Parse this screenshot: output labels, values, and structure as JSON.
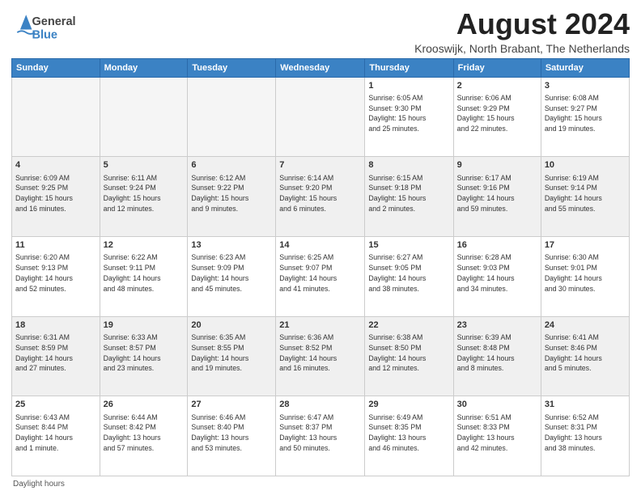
{
  "header": {
    "logo_line1": "General",
    "logo_line2": "Blue",
    "month_title": "August 2024",
    "subtitle": "Krooswijk, North Brabant, The Netherlands"
  },
  "footer": {
    "daylight_label": "Daylight hours"
  },
  "weekdays": [
    "Sunday",
    "Monday",
    "Tuesday",
    "Wednesday",
    "Thursday",
    "Friday",
    "Saturday"
  ],
  "weeks": [
    [
      {
        "day": "",
        "info": "",
        "empty": true
      },
      {
        "day": "",
        "info": "",
        "empty": true
      },
      {
        "day": "",
        "info": "",
        "empty": true
      },
      {
        "day": "",
        "info": "",
        "empty": true
      },
      {
        "day": "1",
        "info": "Sunrise: 6:05 AM\nSunset: 9:30 PM\nDaylight: 15 hours\nand 25 minutes.",
        "empty": false
      },
      {
        "day": "2",
        "info": "Sunrise: 6:06 AM\nSunset: 9:29 PM\nDaylight: 15 hours\nand 22 minutes.",
        "empty": false
      },
      {
        "day": "3",
        "info": "Sunrise: 6:08 AM\nSunset: 9:27 PM\nDaylight: 15 hours\nand 19 minutes.",
        "empty": false
      }
    ],
    [
      {
        "day": "4",
        "info": "Sunrise: 6:09 AM\nSunset: 9:25 PM\nDaylight: 15 hours\nand 16 minutes.",
        "empty": false
      },
      {
        "day": "5",
        "info": "Sunrise: 6:11 AM\nSunset: 9:24 PM\nDaylight: 15 hours\nand 12 minutes.",
        "empty": false
      },
      {
        "day": "6",
        "info": "Sunrise: 6:12 AM\nSunset: 9:22 PM\nDaylight: 15 hours\nand 9 minutes.",
        "empty": false
      },
      {
        "day": "7",
        "info": "Sunrise: 6:14 AM\nSunset: 9:20 PM\nDaylight: 15 hours\nand 6 minutes.",
        "empty": false
      },
      {
        "day": "8",
        "info": "Sunrise: 6:15 AM\nSunset: 9:18 PM\nDaylight: 15 hours\nand 2 minutes.",
        "empty": false
      },
      {
        "day": "9",
        "info": "Sunrise: 6:17 AM\nSunset: 9:16 PM\nDaylight: 14 hours\nand 59 minutes.",
        "empty": false
      },
      {
        "day": "10",
        "info": "Sunrise: 6:19 AM\nSunset: 9:14 PM\nDaylight: 14 hours\nand 55 minutes.",
        "empty": false
      }
    ],
    [
      {
        "day": "11",
        "info": "Sunrise: 6:20 AM\nSunset: 9:13 PM\nDaylight: 14 hours\nand 52 minutes.",
        "empty": false
      },
      {
        "day": "12",
        "info": "Sunrise: 6:22 AM\nSunset: 9:11 PM\nDaylight: 14 hours\nand 48 minutes.",
        "empty": false
      },
      {
        "day": "13",
        "info": "Sunrise: 6:23 AM\nSunset: 9:09 PM\nDaylight: 14 hours\nand 45 minutes.",
        "empty": false
      },
      {
        "day": "14",
        "info": "Sunrise: 6:25 AM\nSunset: 9:07 PM\nDaylight: 14 hours\nand 41 minutes.",
        "empty": false
      },
      {
        "day": "15",
        "info": "Sunrise: 6:27 AM\nSunset: 9:05 PM\nDaylight: 14 hours\nand 38 minutes.",
        "empty": false
      },
      {
        "day": "16",
        "info": "Sunrise: 6:28 AM\nSunset: 9:03 PM\nDaylight: 14 hours\nand 34 minutes.",
        "empty": false
      },
      {
        "day": "17",
        "info": "Sunrise: 6:30 AM\nSunset: 9:01 PM\nDaylight: 14 hours\nand 30 minutes.",
        "empty": false
      }
    ],
    [
      {
        "day": "18",
        "info": "Sunrise: 6:31 AM\nSunset: 8:59 PM\nDaylight: 14 hours\nand 27 minutes.",
        "empty": false
      },
      {
        "day": "19",
        "info": "Sunrise: 6:33 AM\nSunset: 8:57 PM\nDaylight: 14 hours\nand 23 minutes.",
        "empty": false
      },
      {
        "day": "20",
        "info": "Sunrise: 6:35 AM\nSunset: 8:55 PM\nDaylight: 14 hours\nand 19 minutes.",
        "empty": false
      },
      {
        "day": "21",
        "info": "Sunrise: 6:36 AM\nSunset: 8:52 PM\nDaylight: 14 hours\nand 16 minutes.",
        "empty": false
      },
      {
        "day": "22",
        "info": "Sunrise: 6:38 AM\nSunset: 8:50 PM\nDaylight: 14 hours\nand 12 minutes.",
        "empty": false
      },
      {
        "day": "23",
        "info": "Sunrise: 6:39 AM\nSunset: 8:48 PM\nDaylight: 14 hours\nand 8 minutes.",
        "empty": false
      },
      {
        "day": "24",
        "info": "Sunrise: 6:41 AM\nSunset: 8:46 PM\nDaylight: 14 hours\nand 5 minutes.",
        "empty": false
      }
    ],
    [
      {
        "day": "25",
        "info": "Sunrise: 6:43 AM\nSunset: 8:44 PM\nDaylight: 14 hours\nand 1 minute.",
        "empty": false
      },
      {
        "day": "26",
        "info": "Sunrise: 6:44 AM\nSunset: 8:42 PM\nDaylight: 13 hours\nand 57 minutes.",
        "empty": false
      },
      {
        "day": "27",
        "info": "Sunrise: 6:46 AM\nSunset: 8:40 PM\nDaylight: 13 hours\nand 53 minutes.",
        "empty": false
      },
      {
        "day": "28",
        "info": "Sunrise: 6:47 AM\nSunset: 8:37 PM\nDaylight: 13 hours\nand 50 minutes.",
        "empty": false
      },
      {
        "day": "29",
        "info": "Sunrise: 6:49 AM\nSunset: 8:35 PM\nDaylight: 13 hours\nand 46 minutes.",
        "empty": false
      },
      {
        "day": "30",
        "info": "Sunrise: 6:51 AM\nSunset: 8:33 PM\nDaylight: 13 hours\nand 42 minutes.",
        "empty": false
      },
      {
        "day": "31",
        "info": "Sunrise: 6:52 AM\nSunset: 8:31 PM\nDaylight: 13 hours\nand 38 minutes.",
        "empty": false
      }
    ]
  ]
}
